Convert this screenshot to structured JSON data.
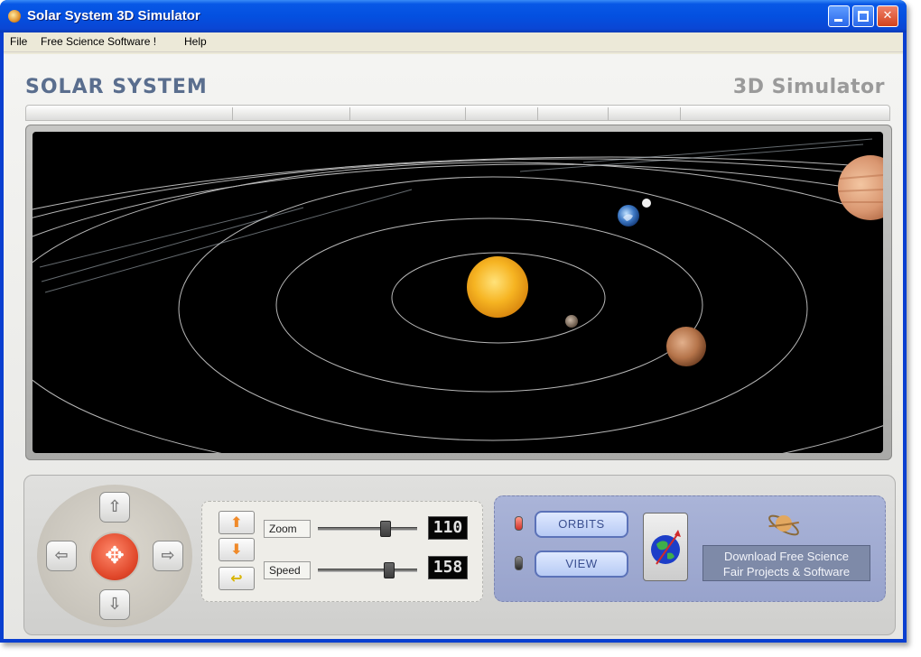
{
  "window": {
    "title": "Solar System 3D Simulator",
    "controls": {
      "minimize": "",
      "maximize": "",
      "close": "✕"
    }
  },
  "menu": {
    "items": [
      "File",
      "Free Science Software !",
      "Help"
    ]
  },
  "app": {
    "title_left": "SOLAR SYSTEM",
    "title_right": "3D Simulator"
  },
  "navigation": {
    "up": "⇧",
    "down": "⇩",
    "left": "⇦",
    "right": "⇨",
    "center": "✥"
  },
  "sliders": {
    "up_button": "⬆",
    "down_button": "⬇",
    "return_button": "↩",
    "zoom": {
      "label": "Zoom",
      "value": "110",
      "position": 0.7
    },
    "speed": {
      "label": "Speed",
      "value": "158",
      "position": 0.74
    }
  },
  "view_panel": {
    "orbits_label": "ORBITS",
    "view_label": "VIEW",
    "download_line1": "Download Free Science",
    "download_line2": "Fair Projects & Software"
  },
  "colors": {
    "titlebar": "#0450e0",
    "sun": "#f6b422",
    "viewport": "#000000",
    "center_button": "#e0472a",
    "view_panel": "#a2acd4"
  }
}
